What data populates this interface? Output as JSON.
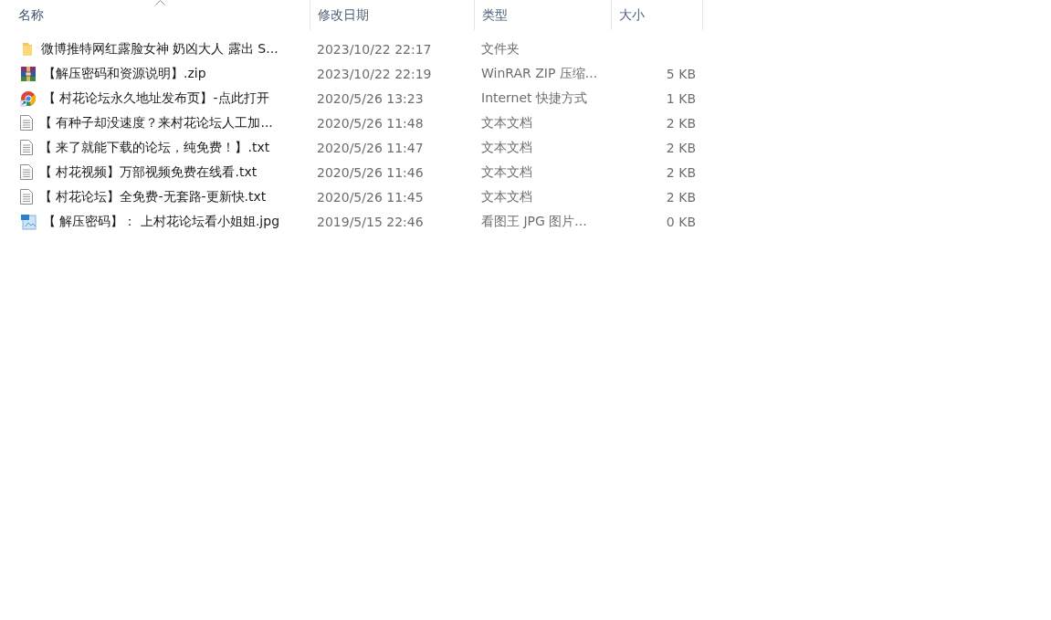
{
  "columns": [
    {
      "label": "名称",
      "sorted": true
    },
    {
      "label": "修改日期",
      "sorted": false
    },
    {
      "label": "类型",
      "sorted": false
    },
    {
      "label": "大小",
      "sorted": false
    }
  ],
  "files": [
    {
      "kind": "folder",
      "name": "微博推特网红露脸女神 奶凶大人 露出 S...",
      "modified": "2023/10/22 22:17",
      "type": "文件夹"
    },
    {
      "kind": "zip",
      "name": "【解压密码和资源说明】.zip",
      "modified": "2023/10/22 22:19",
      "type": "WinRAR ZIP 压缩...",
      "size": "5 KB"
    },
    {
      "kind": "shortcut",
      "name": "【 村花论坛永久地址发布页】-点此打开",
      "modified": "2020/5/26 13:23",
      "type": "Internet 快捷方式",
      "size": "1 KB"
    },
    {
      "kind": "text",
      "name": "【 有种子却没速度？来村花论坛人工加...",
      "modified": "2020/5/26 11:48",
      "type": "文本文档",
      "size": "2 KB"
    },
    {
      "kind": "text",
      "name": "【 来了就能下载的论坛，纯免费！】.txt",
      "modified": "2020/5/26 11:47",
      "type": "文本文档",
      "size": "2 KB"
    },
    {
      "kind": "text",
      "name": "【 村花视频】万部视频免费在线看.txt",
      "modified": "2020/5/26 11:46",
      "type": "文本文档",
      "size": "2 KB"
    },
    {
      "kind": "text",
      "name": "【 村花论坛】全免费-无套路-更新快.txt",
      "modified": "2020/5/26 11:45",
      "type": "文本文档",
      "size": "2 KB"
    },
    {
      "kind": "image",
      "name": "【 解压密码】： 上村花论坛看小姐姐.jpg",
      "modified": "2019/5/15 22:46",
      "type": "看图王 JPG 图片...",
      "size": "0 KB"
    }
  ]
}
